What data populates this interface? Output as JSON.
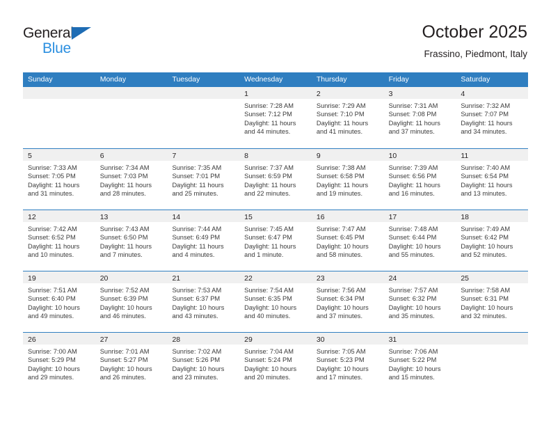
{
  "brand": {
    "name_part1": "General",
    "name_part2": "Blue",
    "triangle_color": "#1e6cb4",
    "blue_color": "#2b8fe0"
  },
  "header": {
    "title": "October 2025",
    "subtitle": "Frassino, Piedmont, Italy"
  },
  "theme": {
    "header_blue": "#2f7ec0",
    "daynum_band": "#f0f0f0",
    "text": "#231f20"
  },
  "weekdays": [
    "Sunday",
    "Monday",
    "Tuesday",
    "Wednesday",
    "Thursday",
    "Friday",
    "Saturday"
  ],
  "weeks": [
    [
      {
        "day": "",
        "l1": "",
        "l2": "",
        "l3": "",
        "l4": ""
      },
      {
        "day": "",
        "l1": "",
        "l2": "",
        "l3": "",
        "l4": ""
      },
      {
        "day": "",
        "l1": "",
        "l2": "",
        "l3": "",
        "l4": ""
      },
      {
        "day": "1",
        "l1": "Sunrise: 7:28 AM",
        "l2": "Sunset: 7:12 PM",
        "l3": "Daylight: 11 hours",
        "l4": "and 44 minutes."
      },
      {
        "day": "2",
        "l1": "Sunrise: 7:29 AM",
        "l2": "Sunset: 7:10 PM",
        "l3": "Daylight: 11 hours",
        "l4": "and 41 minutes."
      },
      {
        "day": "3",
        "l1": "Sunrise: 7:31 AM",
        "l2": "Sunset: 7:08 PM",
        "l3": "Daylight: 11 hours",
        "l4": "and 37 minutes."
      },
      {
        "day": "4",
        "l1": "Sunrise: 7:32 AM",
        "l2": "Sunset: 7:07 PM",
        "l3": "Daylight: 11 hours",
        "l4": "and 34 minutes."
      }
    ],
    [
      {
        "day": "5",
        "l1": "Sunrise: 7:33 AM",
        "l2": "Sunset: 7:05 PM",
        "l3": "Daylight: 11 hours",
        "l4": "and 31 minutes."
      },
      {
        "day": "6",
        "l1": "Sunrise: 7:34 AM",
        "l2": "Sunset: 7:03 PM",
        "l3": "Daylight: 11 hours",
        "l4": "and 28 minutes."
      },
      {
        "day": "7",
        "l1": "Sunrise: 7:35 AM",
        "l2": "Sunset: 7:01 PM",
        "l3": "Daylight: 11 hours",
        "l4": "and 25 minutes."
      },
      {
        "day": "8",
        "l1": "Sunrise: 7:37 AM",
        "l2": "Sunset: 6:59 PM",
        "l3": "Daylight: 11 hours",
        "l4": "and 22 minutes."
      },
      {
        "day": "9",
        "l1": "Sunrise: 7:38 AM",
        "l2": "Sunset: 6:58 PM",
        "l3": "Daylight: 11 hours",
        "l4": "and 19 minutes."
      },
      {
        "day": "10",
        "l1": "Sunrise: 7:39 AM",
        "l2": "Sunset: 6:56 PM",
        "l3": "Daylight: 11 hours",
        "l4": "and 16 minutes."
      },
      {
        "day": "11",
        "l1": "Sunrise: 7:40 AM",
        "l2": "Sunset: 6:54 PM",
        "l3": "Daylight: 11 hours",
        "l4": "and 13 minutes."
      }
    ],
    [
      {
        "day": "12",
        "l1": "Sunrise: 7:42 AM",
        "l2": "Sunset: 6:52 PM",
        "l3": "Daylight: 11 hours",
        "l4": "and 10 minutes."
      },
      {
        "day": "13",
        "l1": "Sunrise: 7:43 AM",
        "l2": "Sunset: 6:50 PM",
        "l3": "Daylight: 11 hours",
        "l4": "and 7 minutes."
      },
      {
        "day": "14",
        "l1": "Sunrise: 7:44 AM",
        "l2": "Sunset: 6:49 PM",
        "l3": "Daylight: 11 hours",
        "l4": "and 4 minutes."
      },
      {
        "day": "15",
        "l1": "Sunrise: 7:45 AM",
        "l2": "Sunset: 6:47 PM",
        "l3": "Daylight: 11 hours",
        "l4": "and 1 minute."
      },
      {
        "day": "16",
        "l1": "Sunrise: 7:47 AM",
        "l2": "Sunset: 6:45 PM",
        "l3": "Daylight: 10 hours",
        "l4": "and 58 minutes."
      },
      {
        "day": "17",
        "l1": "Sunrise: 7:48 AM",
        "l2": "Sunset: 6:44 PM",
        "l3": "Daylight: 10 hours",
        "l4": "and 55 minutes."
      },
      {
        "day": "18",
        "l1": "Sunrise: 7:49 AM",
        "l2": "Sunset: 6:42 PM",
        "l3": "Daylight: 10 hours",
        "l4": "and 52 minutes."
      }
    ],
    [
      {
        "day": "19",
        "l1": "Sunrise: 7:51 AM",
        "l2": "Sunset: 6:40 PM",
        "l3": "Daylight: 10 hours",
        "l4": "and 49 minutes."
      },
      {
        "day": "20",
        "l1": "Sunrise: 7:52 AM",
        "l2": "Sunset: 6:39 PM",
        "l3": "Daylight: 10 hours",
        "l4": "and 46 minutes."
      },
      {
        "day": "21",
        "l1": "Sunrise: 7:53 AM",
        "l2": "Sunset: 6:37 PM",
        "l3": "Daylight: 10 hours",
        "l4": "and 43 minutes."
      },
      {
        "day": "22",
        "l1": "Sunrise: 7:54 AM",
        "l2": "Sunset: 6:35 PM",
        "l3": "Daylight: 10 hours",
        "l4": "and 40 minutes."
      },
      {
        "day": "23",
        "l1": "Sunrise: 7:56 AM",
        "l2": "Sunset: 6:34 PM",
        "l3": "Daylight: 10 hours",
        "l4": "and 37 minutes."
      },
      {
        "day": "24",
        "l1": "Sunrise: 7:57 AM",
        "l2": "Sunset: 6:32 PM",
        "l3": "Daylight: 10 hours",
        "l4": "and 35 minutes."
      },
      {
        "day": "25",
        "l1": "Sunrise: 7:58 AM",
        "l2": "Sunset: 6:31 PM",
        "l3": "Daylight: 10 hours",
        "l4": "and 32 minutes."
      }
    ],
    [
      {
        "day": "26",
        "l1": "Sunrise: 7:00 AM",
        "l2": "Sunset: 5:29 PM",
        "l3": "Daylight: 10 hours",
        "l4": "and 29 minutes."
      },
      {
        "day": "27",
        "l1": "Sunrise: 7:01 AM",
        "l2": "Sunset: 5:27 PM",
        "l3": "Daylight: 10 hours",
        "l4": "and 26 minutes."
      },
      {
        "day": "28",
        "l1": "Sunrise: 7:02 AM",
        "l2": "Sunset: 5:26 PM",
        "l3": "Daylight: 10 hours",
        "l4": "and 23 minutes."
      },
      {
        "day": "29",
        "l1": "Sunrise: 7:04 AM",
        "l2": "Sunset: 5:24 PM",
        "l3": "Daylight: 10 hours",
        "l4": "and 20 minutes."
      },
      {
        "day": "30",
        "l1": "Sunrise: 7:05 AM",
        "l2": "Sunset: 5:23 PM",
        "l3": "Daylight: 10 hours",
        "l4": "and 17 minutes."
      },
      {
        "day": "31",
        "l1": "Sunrise: 7:06 AM",
        "l2": "Sunset: 5:22 PM",
        "l3": "Daylight: 10 hours",
        "l4": "and 15 minutes."
      },
      {
        "day": "",
        "l1": "",
        "l2": "",
        "l3": "",
        "l4": ""
      }
    ]
  ]
}
